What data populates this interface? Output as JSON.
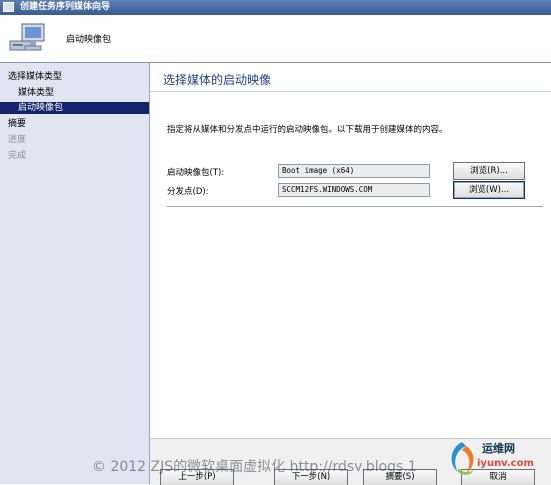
{
  "window": {
    "title": "创建任务序列媒体向导"
  },
  "header": {
    "title": "启动映像包",
    "icon": "computer-icon"
  },
  "sidebar": {
    "items": [
      {
        "label": "选择媒体类型",
        "state": "normal"
      },
      {
        "label": "媒体类型",
        "state": "normal"
      },
      {
        "label": "启动映像包",
        "state": "selected"
      },
      {
        "label": "摘要",
        "state": "normal"
      },
      {
        "label": "进度",
        "state": "disabled"
      },
      {
        "label": "完成",
        "state": "disabled"
      }
    ]
  },
  "main": {
    "title": "选择媒体的启动映像",
    "description": "指定将从媒体和分发点中运行的启动映像包。以下载用于创建媒体的内容。",
    "fields": [
      {
        "label": "启动映像包(T):",
        "value": "Boot image (x64)",
        "button": "浏览(R)..."
      },
      {
        "label": "分发点(D):",
        "value": "SCCM12FS.WINDOWS.COM",
        "button": "浏览(W)..."
      }
    ]
  },
  "footer": {
    "buttons": [
      "上一步(P)",
      "下一步(N)",
      "摘要(S)",
      "取消"
    ]
  },
  "watermark": "© 2012 ZJS的微软桌面虚拟化 http://rdsv.blogs.1",
  "logo": {
    "text": "运维网",
    "url": "iyunv.com"
  },
  "colors": {
    "selected_bg": "#15236a",
    "sidebar_bg": "#dfe6f1",
    "title_text": "#1d4189"
  }
}
